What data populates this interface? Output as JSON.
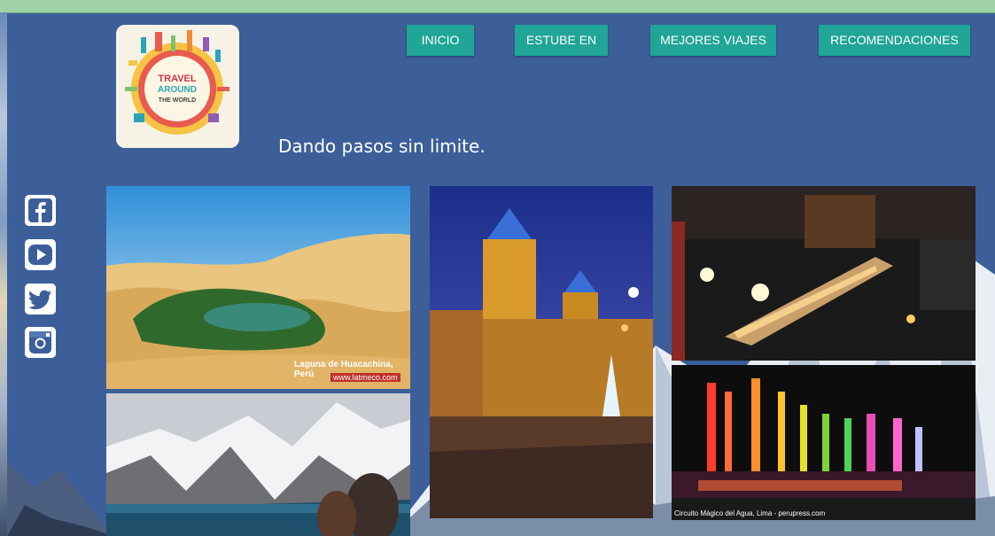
{
  "nav": {
    "items": [
      {
        "label": "INICIO"
      },
      {
        "label": "ESTUBE EN"
      },
      {
        "label": "MEJORES VIAJES"
      },
      {
        "label": "RECOMENDACIONES"
      }
    ]
  },
  "logo": {
    "line1": "TRAVEL",
    "line2": "AROUND",
    "line3": "THE WORLD"
  },
  "tagline": "Dando pasos sin limite.",
  "social": [
    {
      "icon": "facebook-icon"
    },
    {
      "icon": "youtube-icon"
    },
    {
      "icon": "twitter-icon"
    },
    {
      "icon": "instagram-icon"
    }
  ],
  "gallery": {
    "huacachina": {
      "caption": "Laguna de Huacachina, Perú",
      "credit": "www.latmeco.com"
    },
    "fountain": {
      "caption": "Circuito Mágico del Agua, Lima - perupress.com"
    }
  },
  "colors": {
    "nav_button": "#20a596",
    "background": "#3c5f9a",
    "top_bar": "#9fd3a6"
  }
}
